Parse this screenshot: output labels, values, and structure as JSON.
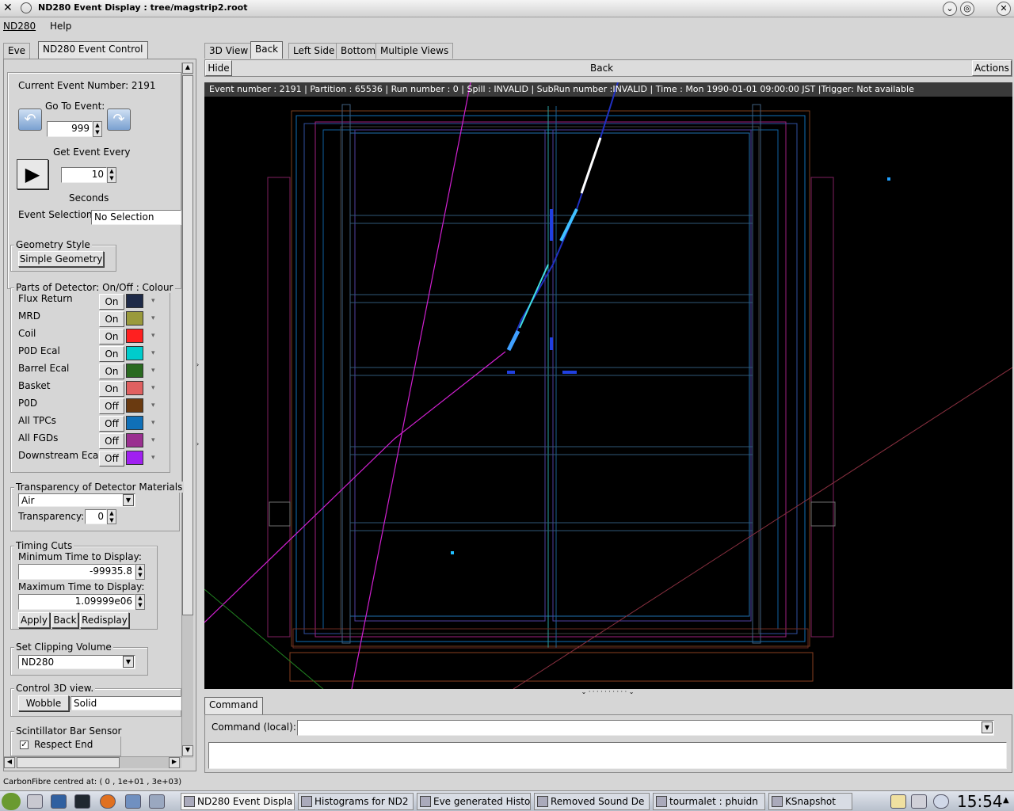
{
  "window": {
    "title": "ND280 Event Display : tree/magstrip2.root"
  },
  "menu": [
    "ND280",
    "Help"
  ],
  "left_tabs": [
    "Eve",
    "ND280 Event Control"
  ],
  "view_tabs": [
    "3D View",
    "Back",
    "Left Side",
    "Bottom",
    "Multiple Views"
  ],
  "viewer_header": {
    "hide": "Hide",
    "title": "Back",
    "actions": "Actions"
  },
  "event_info": "Event number : 2191 | Partition : 65536 | Run number : 0 | Spill : INVALID | SubRun number :INVALID | Time : Mon 1990-01-01 09:00:00 JST |Trigger: Not available",
  "control": {
    "current_event": "Current Event Number:  2191",
    "goto_label": "Go To Event:",
    "goto_value": "999",
    "get_every": "Get Event Every",
    "every_value": "10",
    "seconds": "Seconds",
    "selection_label": "Event Selection:",
    "selection_value": "No Selection"
  },
  "geometry": {
    "title": "Geometry Style",
    "button": "Simple Geometry"
  },
  "parts": {
    "title": "Parts of Detector: On/Off : Colour",
    "items": [
      {
        "name": "Flux Return",
        "state": "On",
        "color": "#1e2a48"
      },
      {
        "name": "MRD",
        "state": "On",
        "color": "#9a9a3c"
      },
      {
        "name": "Coil",
        "state": "On",
        "color": "#ff2020"
      },
      {
        "name": "P0D Ecal",
        "state": "On",
        "color": "#00cccc"
      },
      {
        "name": "Barrel Ecal",
        "state": "On",
        "color": "#2a6a20"
      },
      {
        "name": "Basket",
        "state": "On",
        "color": "#e06060"
      },
      {
        "name": "P0D",
        "state": "Off",
        "color": "#6a3a10"
      },
      {
        "name": "All TPCs",
        "state": "Off",
        "color": "#1070b8"
      },
      {
        "name": "All FGDs",
        "state": "Off",
        "color": "#9a3090"
      },
      {
        "name": "Downstream Ecal",
        "state": "Off",
        "color": "#a020f0"
      }
    ]
  },
  "transparency": {
    "title": "Transparency of Detector Materials",
    "material": "Air",
    "label": "Transparency:",
    "value": "0"
  },
  "timing": {
    "title": "Timing Cuts",
    "min_label": "Minimum Time to Display:",
    "min_value": "-99935.8",
    "max_label": "Maximum Time to Display:",
    "max_value": "1.09999e06",
    "apply": "Apply",
    "back": "Back",
    "redisplay": "Redisplay"
  },
  "clipping": {
    "title": "Set Clipping Volume",
    "value": "ND280"
  },
  "control3d": {
    "title": "Control 3D view.",
    "wobble": "Wobble",
    "mode": "Solid"
  },
  "scint": {
    "title": "Scintillator Bar Sensor",
    "respect": "Respect End"
  },
  "command": {
    "tab": "Command",
    "label": "Command (local):",
    "value": ""
  },
  "status_line": "CarbonFibre centred at: (    0 ,  1e+01 , 3e+03)",
  "taskbar": {
    "tasks": [
      "ND280 Event Displa",
      "Histograms for ND2",
      "Eve generated Histo",
      "Removed Sound De",
      "tourmalet : phuidn",
      "KSnapshot"
    ],
    "clock": "15:54"
  },
  "colors": {
    "accent": "#a0a0a0",
    "viewer_bg": "#000000",
    "track_magenta": "#d020d0",
    "track_cyan": "#40c0ff"
  }
}
